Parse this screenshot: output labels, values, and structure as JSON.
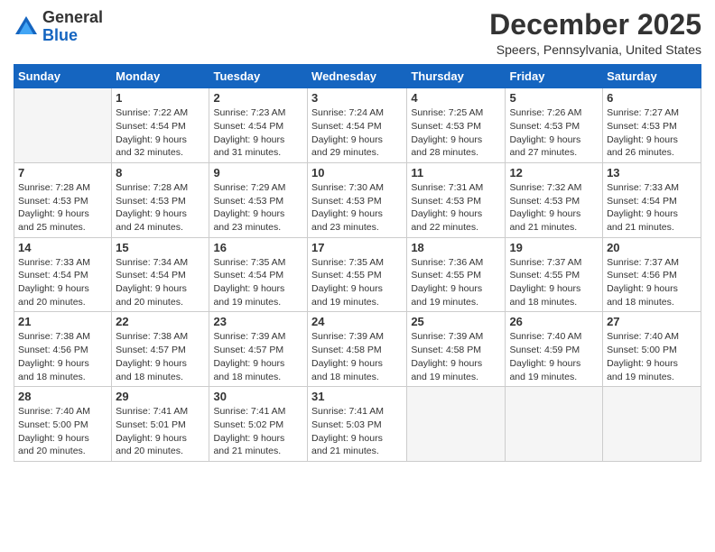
{
  "logo": {
    "general": "General",
    "blue": "Blue"
  },
  "title": "December 2025",
  "location": "Speers, Pennsylvania, United States",
  "days_of_week": [
    "Sunday",
    "Monday",
    "Tuesday",
    "Wednesday",
    "Thursday",
    "Friday",
    "Saturday"
  ],
  "weeks": [
    [
      {
        "day": "",
        "sunrise": "",
        "sunset": "",
        "daylight": "",
        "empty": true
      },
      {
        "day": "1",
        "sunrise": "Sunrise: 7:22 AM",
        "sunset": "Sunset: 4:54 PM",
        "daylight": "Daylight: 9 hours and 32 minutes."
      },
      {
        "day": "2",
        "sunrise": "Sunrise: 7:23 AM",
        "sunset": "Sunset: 4:54 PM",
        "daylight": "Daylight: 9 hours and 31 minutes."
      },
      {
        "day": "3",
        "sunrise": "Sunrise: 7:24 AM",
        "sunset": "Sunset: 4:54 PM",
        "daylight": "Daylight: 9 hours and 29 minutes."
      },
      {
        "day": "4",
        "sunrise": "Sunrise: 7:25 AM",
        "sunset": "Sunset: 4:53 PM",
        "daylight": "Daylight: 9 hours and 28 minutes."
      },
      {
        "day": "5",
        "sunrise": "Sunrise: 7:26 AM",
        "sunset": "Sunset: 4:53 PM",
        "daylight": "Daylight: 9 hours and 27 minutes."
      },
      {
        "day": "6",
        "sunrise": "Sunrise: 7:27 AM",
        "sunset": "Sunset: 4:53 PM",
        "daylight": "Daylight: 9 hours and 26 minutes."
      }
    ],
    [
      {
        "day": "7",
        "sunrise": "Sunrise: 7:28 AM",
        "sunset": "Sunset: 4:53 PM",
        "daylight": "Daylight: 9 hours and 25 minutes."
      },
      {
        "day": "8",
        "sunrise": "Sunrise: 7:28 AM",
        "sunset": "Sunset: 4:53 PM",
        "daylight": "Daylight: 9 hours and 24 minutes."
      },
      {
        "day": "9",
        "sunrise": "Sunrise: 7:29 AM",
        "sunset": "Sunset: 4:53 PM",
        "daylight": "Daylight: 9 hours and 23 minutes."
      },
      {
        "day": "10",
        "sunrise": "Sunrise: 7:30 AM",
        "sunset": "Sunset: 4:53 PM",
        "daylight": "Daylight: 9 hours and 23 minutes."
      },
      {
        "day": "11",
        "sunrise": "Sunrise: 7:31 AM",
        "sunset": "Sunset: 4:53 PM",
        "daylight": "Daylight: 9 hours and 22 minutes."
      },
      {
        "day": "12",
        "sunrise": "Sunrise: 7:32 AM",
        "sunset": "Sunset: 4:53 PM",
        "daylight": "Daylight: 9 hours and 21 minutes."
      },
      {
        "day": "13",
        "sunrise": "Sunrise: 7:33 AM",
        "sunset": "Sunset: 4:54 PM",
        "daylight": "Daylight: 9 hours and 21 minutes."
      }
    ],
    [
      {
        "day": "14",
        "sunrise": "Sunrise: 7:33 AM",
        "sunset": "Sunset: 4:54 PM",
        "daylight": "Daylight: 9 hours and 20 minutes."
      },
      {
        "day": "15",
        "sunrise": "Sunrise: 7:34 AM",
        "sunset": "Sunset: 4:54 PM",
        "daylight": "Daylight: 9 hours and 20 minutes."
      },
      {
        "day": "16",
        "sunrise": "Sunrise: 7:35 AM",
        "sunset": "Sunset: 4:54 PM",
        "daylight": "Daylight: 9 hours and 19 minutes."
      },
      {
        "day": "17",
        "sunrise": "Sunrise: 7:35 AM",
        "sunset": "Sunset: 4:55 PM",
        "daylight": "Daylight: 9 hours and 19 minutes."
      },
      {
        "day": "18",
        "sunrise": "Sunrise: 7:36 AM",
        "sunset": "Sunset: 4:55 PM",
        "daylight": "Daylight: 9 hours and 19 minutes."
      },
      {
        "day": "19",
        "sunrise": "Sunrise: 7:37 AM",
        "sunset": "Sunset: 4:55 PM",
        "daylight": "Daylight: 9 hours and 18 minutes."
      },
      {
        "day": "20",
        "sunrise": "Sunrise: 7:37 AM",
        "sunset": "Sunset: 4:56 PM",
        "daylight": "Daylight: 9 hours and 18 minutes."
      }
    ],
    [
      {
        "day": "21",
        "sunrise": "Sunrise: 7:38 AM",
        "sunset": "Sunset: 4:56 PM",
        "daylight": "Daylight: 9 hours and 18 minutes."
      },
      {
        "day": "22",
        "sunrise": "Sunrise: 7:38 AM",
        "sunset": "Sunset: 4:57 PM",
        "daylight": "Daylight: 9 hours and 18 minutes."
      },
      {
        "day": "23",
        "sunrise": "Sunrise: 7:39 AM",
        "sunset": "Sunset: 4:57 PM",
        "daylight": "Daylight: 9 hours and 18 minutes."
      },
      {
        "day": "24",
        "sunrise": "Sunrise: 7:39 AM",
        "sunset": "Sunset: 4:58 PM",
        "daylight": "Daylight: 9 hours and 18 minutes."
      },
      {
        "day": "25",
        "sunrise": "Sunrise: 7:39 AM",
        "sunset": "Sunset: 4:58 PM",
        "daylight": "Daylight: 9 hours and 19 minutes."
      },
      {
        "day": "26",
        "sunrise": "Sunrise: 7:40 AM",
        "sunset": "Sunset: 4:59 PM",
        "daylight": "Daylight: 9 hours and 19 minutes."
      },
      {
        "day": "27",
        "sunrise": "Sunrise: 7:40 AM",
        "sunset": "Sunset: 5:00 PM",
        "daylight": "Daylight: 9 hours and 19 minutes."
      }
    ],
    [
      {
        "day": "28",
        "sunrise": "Sunrise: 7:40 AM",
        "sunset": "Sunset: 5:00 PM",
        "daylight": "Daylight: 9 hours and 20 minutes."
      },
      {
        "day": "29",
        "sunrise": "Sunrise: 7:41 AM",
        "sunset": "Sunset: 5:01 PM",
        "daylight": "Daylight: 9 hours and 20 minutes."
      },
      {
        "day": "30",
        "sunrise": "Sunrise: 7:41 AM",
        "sunset": "Sunset: 5:02 PM",
        "daylight": "Daylight: 9 hours and 21 minutes."
      },
      {
        "day": "31",
        "sunrise": "Sunrise: 7:41 AM",
        "sunset": "Sunset: 5:03 PM",
        "daylight": "Daylight: 9 hours and 21 minutes."
      },
      {
        "day": "",
        "sunrise": "",
        "sunset": "",
        "daylight": "",
        "empty": true
      },
      {
        "day": "",
        "sunrise": "",
        "sunset": "",
        "daylight": "",
        "empty": true
      },
      {
        "day": "",
        "sunrise": "",
        "sunset": "",
        "daylight": "",
        "empty": true
      }
    ]
  ]
}
